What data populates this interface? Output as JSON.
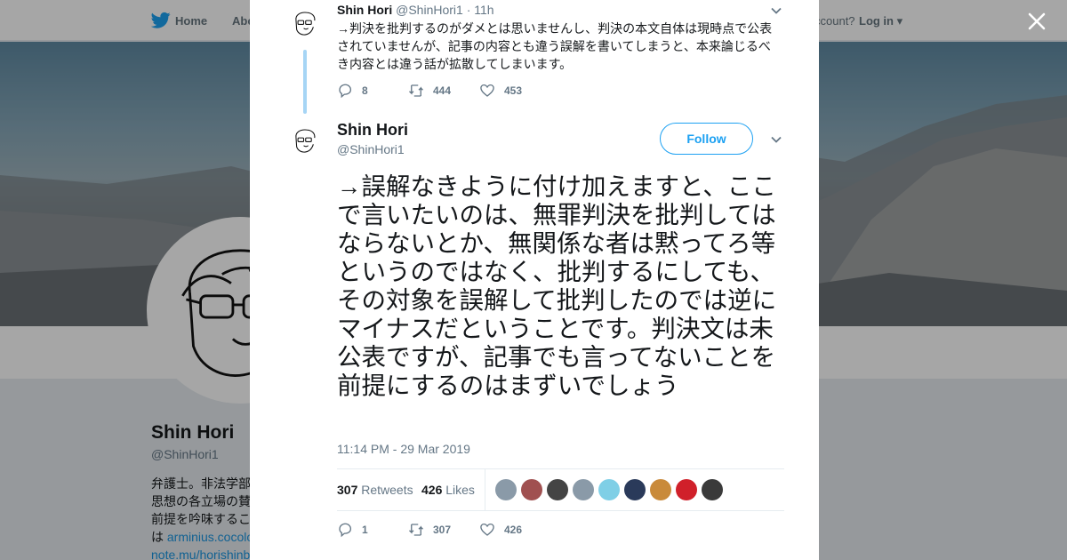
{
  "nav": {
    "home_label": "Home",
    "about_label": "Abo",
    "account_prompt": "ccount?",
    "login_label": "Log in"
  },
  "profile": {
    "name": "Shin Hori",
    "handle": "@ShinHori1",
    "bio_line1": "弁護士。非法学部",
    "bio_line2": "思想の各立場の賛",
    "bio_line3": "前提を吟味するこ",
    "bio_line4_prefix": "は ",
    "bio_link1": "arminius.cocolo",
    "bio_link2": "note.mu/horishinb"
  },
  "tweet1": {
    "name": "Shin Hori",
    "handle": "@ShinHori1",
    "time": "· 11h",
    "text": "→判決を批判するのがダメとは思いませんし、判決の本文自体は現時点で公表されていませんが、記事の内容とも違う誤解を書いてしまうと、本来論じるべき内容とは違う話が拡散してしまいます。",
    "replies": "8",
    "retweets": "444",
    "likes": "453"
  },
  "tweet2": {
    "name": "Shin Hori",
    "handle": "@ShinHori1",
    "follow_label": "Follow",
    "text": "→誤解なきように付け加えますと、ここで言いたいのは、無罪判決を批判してはならないとか、無関係な者は黙ってろ等というのではなく、批判するにしても、その対象を誤解して批判したのでは逆にマイナスだということです。判決文は未公表ですが、記事でも言ってないことを前提にするのはまずいでしょう",
    "timestamp": "11:14 PM - 29 Mar 2019",
    "retweet_count": "307",
    "retweets_label": "Retweets",
    "like_count": "426",
    "likes_label": "Likes",
    "replies": "1",
    "retweets": "307",
    "likes": "426"
  },
  "likers": [
    {
      "color": "#8a9aa8"
    },
    {
      "color": "#a05050"
    },
    {
      "color": "#444444"
    },
    {
      "color": "#8a9aa8"
    },
    {
      "color": "#7fcfe6"
    },
    {
      "color": "#2a3a5a"
    },
    {
      "color": "#c98a3a"
    },
    {
      "color": "#d0202a"
    },
    {
      "color": "#3a3a3a"
    }
  ],
  "colors": {
    "accent": "#1da1f2",
    "thread_line": "#a6d5f5",
    "text": "#14171a",
    "muted": "#657786"
  },
  "icons": {
    "logo": "twitter-bird-icon",
    "close": "close-icon",
    "reply": "reply-icon",
    "retweet": "retweet-icon",
    "like": "heart-icon",
    "more": "chevron-down-icon"
  }
}
